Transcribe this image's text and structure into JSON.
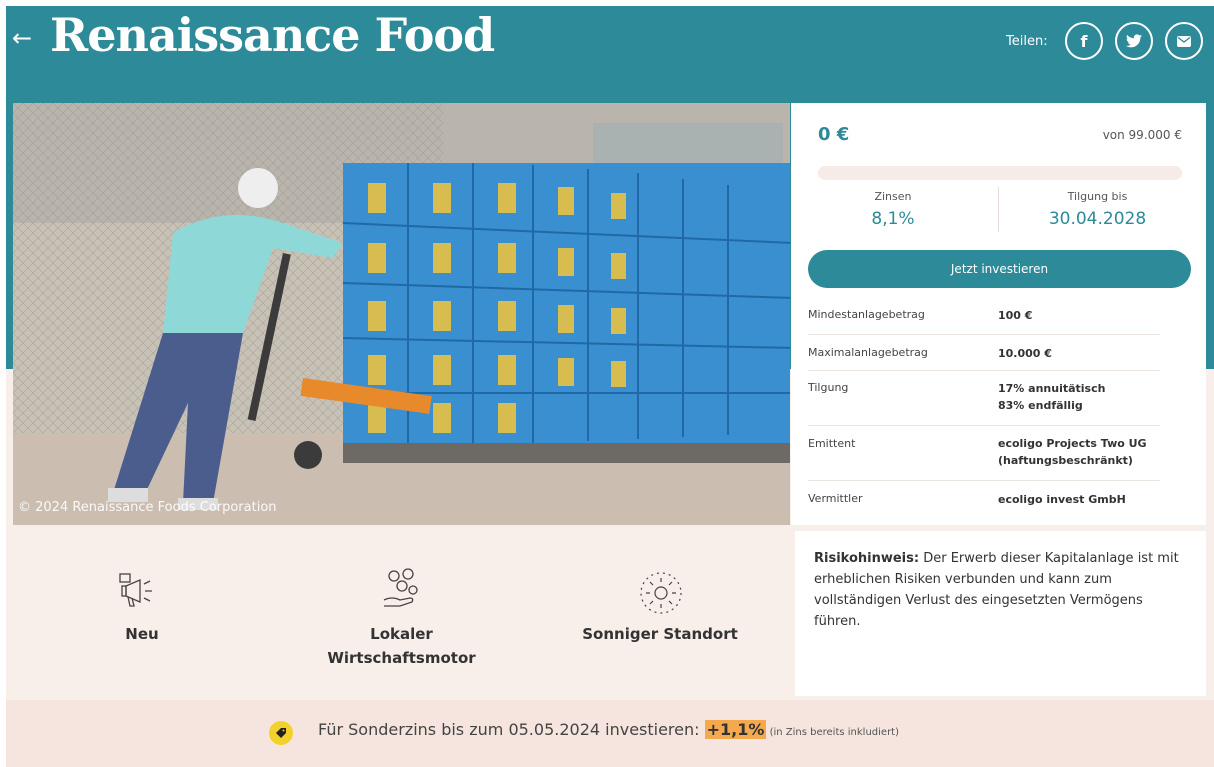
{
  "header": {
    "back_icon": "arrow-left-icon",
    "title": "Renaissance Food",
    "share_label": "Teilen:",
    "share_buttons": [
      {
        "name": "facebook-icon",
        "glyph": "f"
      },
      {
        "name": "twitter-icon",
        "glyph": "🐦"
      },
      {
        "name": "email-icon",
        "glyph": "✉"
      }
    ]
  },
  "photo": {
    "credit": "© 2024 Renaissance Foods Corporation"
  },
  "investment": {
    "current_amount": "0 €",
    "goal": "von 99.000 €",
    "progress_fraction": 0,
    "interest_label": "Zinsen",
    "interest_value": "8,1%",
    "repayment_label": "Tilgung bis",
    "repayment_value": "30.04.2028",
    "invest_button": "Jetzt investieren",
    "details": [
      {
        "label": "Mindestanlagebetrag",
        "value": "100 €"
      },
      {
        "label": "Maximalanlagebetrag",
        "value": "10.000 €"
      },
      {
        "label": "Tilgung",
        "value": "17% annuitätisch\n83% endfällig"
      },
      {
        "label": "Emittent",
        "value": "ecoligo Projects Two UG\n(haftungsbeschränkt)"
      },
      {
        "label": "Vermittler",
        "value": "ecoligo invest GmbH"
      }
    ]
  },
  "features": [
    {
      "icon": "megaphone-icon",
      "label": "Neu"
    },
    {
      "icon": "coins-in-hand-icon",
      "label": "Lokaler\nWirtschaftsmotor"
    },
    {
      "icon": "sun-icon",
      "label": "Sonniger Standort"
    }
  ],
  "risk": {
    "heading": "Risikohinweis:",
    "text": " Der Erwerb dieser Kapitalanlage ist mit erheblichen Risiken verbunden und kann zum vollständigen Verlust des eingesetzten Vermögens führen."
  },
  "promo": {
    "icon": "tag-icon",
    "text": "Für Sonderzins bis zum 05.05.2024 investieren: ",
    "bonus": "+1,1%",
    "note": " (in Zins bereits inkludiert)"
  },
  "colors": {
    "brand_teal": "#2d8a99",
    "background_beige": "#f8eeea",
    "highlight_orange": "#f4a94f",
    "badge_yellow": "#f3d12b"
  }
}
